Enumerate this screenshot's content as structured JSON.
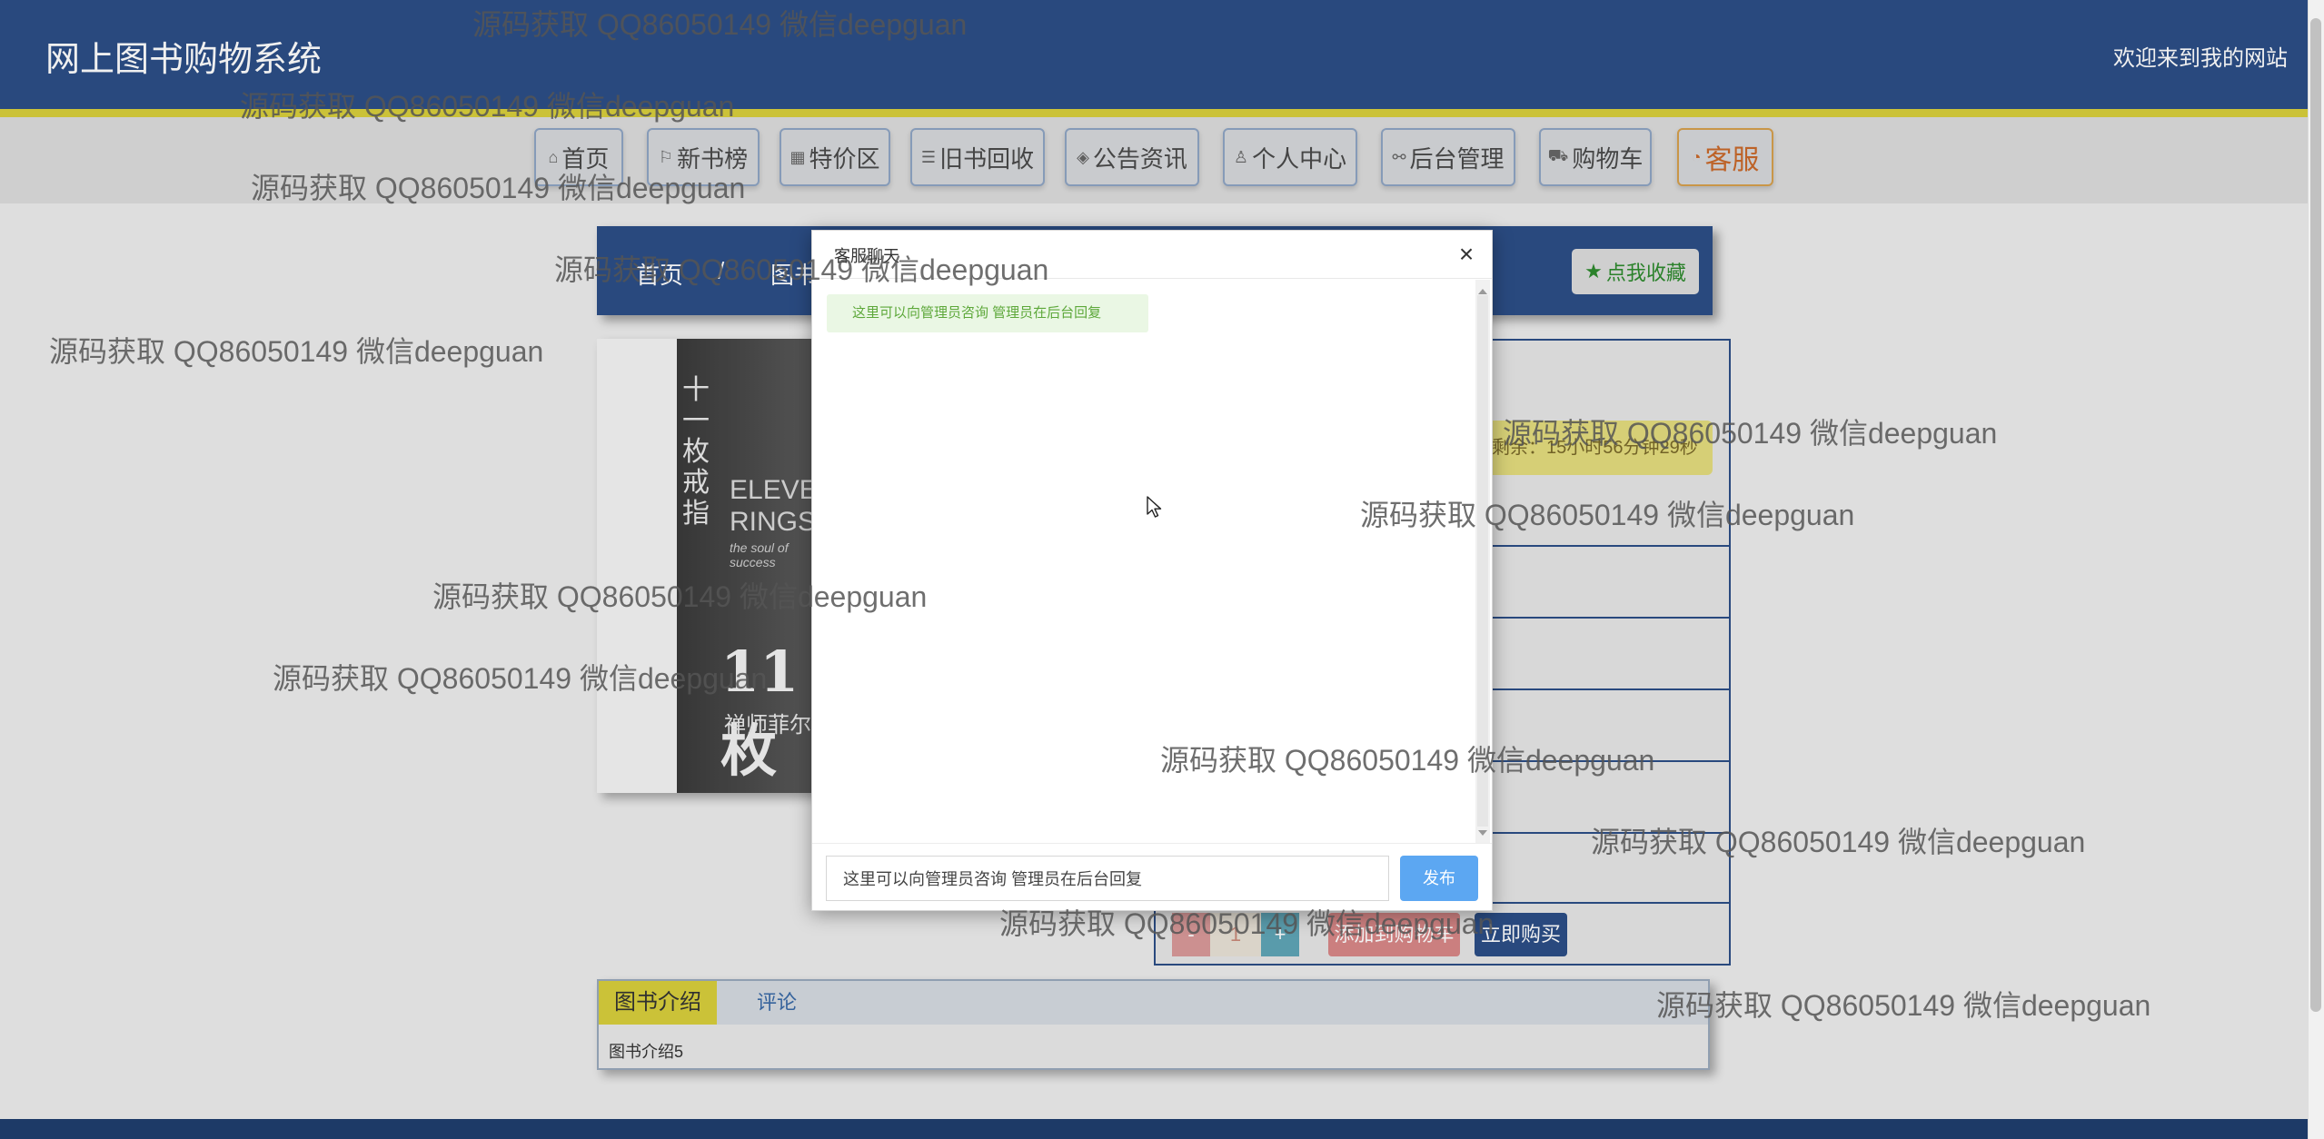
{
  "header": {
    "title": "网上图书购物系统",
    "welcome": "欢迎来到我的网站"
  },
  "nav": {
    "items": [
      {
        "label": "首页",
        "icon": "home-icon"
      },
      {
        "label": "新书榜",
        "icon": "flag-icon"
      },
      {
        "label": "特价区",
        "icon": "apps-icon"
      },
      {
        "label": "旧书回收",
        "icon": "sliders-icon"
      },
      {
        "label": "公告资讯",
        "icon": "layers-icon"
      },
      {
        "label": "个人中心",
        "icon": "user-icon"
      },
      {
        "label": "后台管理",
        "icon": "link-icon"
      },
      {
        "label": "购物车",
        "icon": "cart-icon"
      },
      {
        "label": "客服",
        "icon": "service-icon"
      }
    ]
  },
  "breadcrumb": {
    "home": "首页",
    "separator": "/",
    "category": "图书"
  },
  "favorite": {
    "label": "点我收藏",
    "icon": "star-icon"
  },
  "product": {
    "countdown": "剩余：15小时56分钟29秒",
    "quantity": "1",
    "minus": "-",
    "plus": "+",
    "add_to_cart": "添加到购物车",
    "buy_now": "立即购买"
  },
  "book_cover": {
    "title_cn": "十一枚戒指",
    "title_en_1": "ELEVEN",
    "title_en_2": "RINGS",
    "subtitle": "the soul of success",
    "number": "11枚",
    "author": "禅师菲尔"
  },
  "tabs": {
    "intro": "图书介绍",
    "comment": "评论",
    "intro_text": "图书介绍5"
  },
  "modal": {
    "title": "客服聊天",
    "close": "×",
    "message": "这里可以向管理员咨询 管理员在后台回复",
    "input_value": "这里可以向管理员咨询 管理员在后台回复",
    "send": "发布"
  },
  "watermark": {
    "text": "源码获取 QQ86050149 微信deepguan"
  },
  "colors": {
    "header_bg": "#2c4e86",
    "accent_yellow": "#d8cf3c",
    "send_blue": "#5ca7f2",
    "service_orange": "#c9692a"
  }
}
